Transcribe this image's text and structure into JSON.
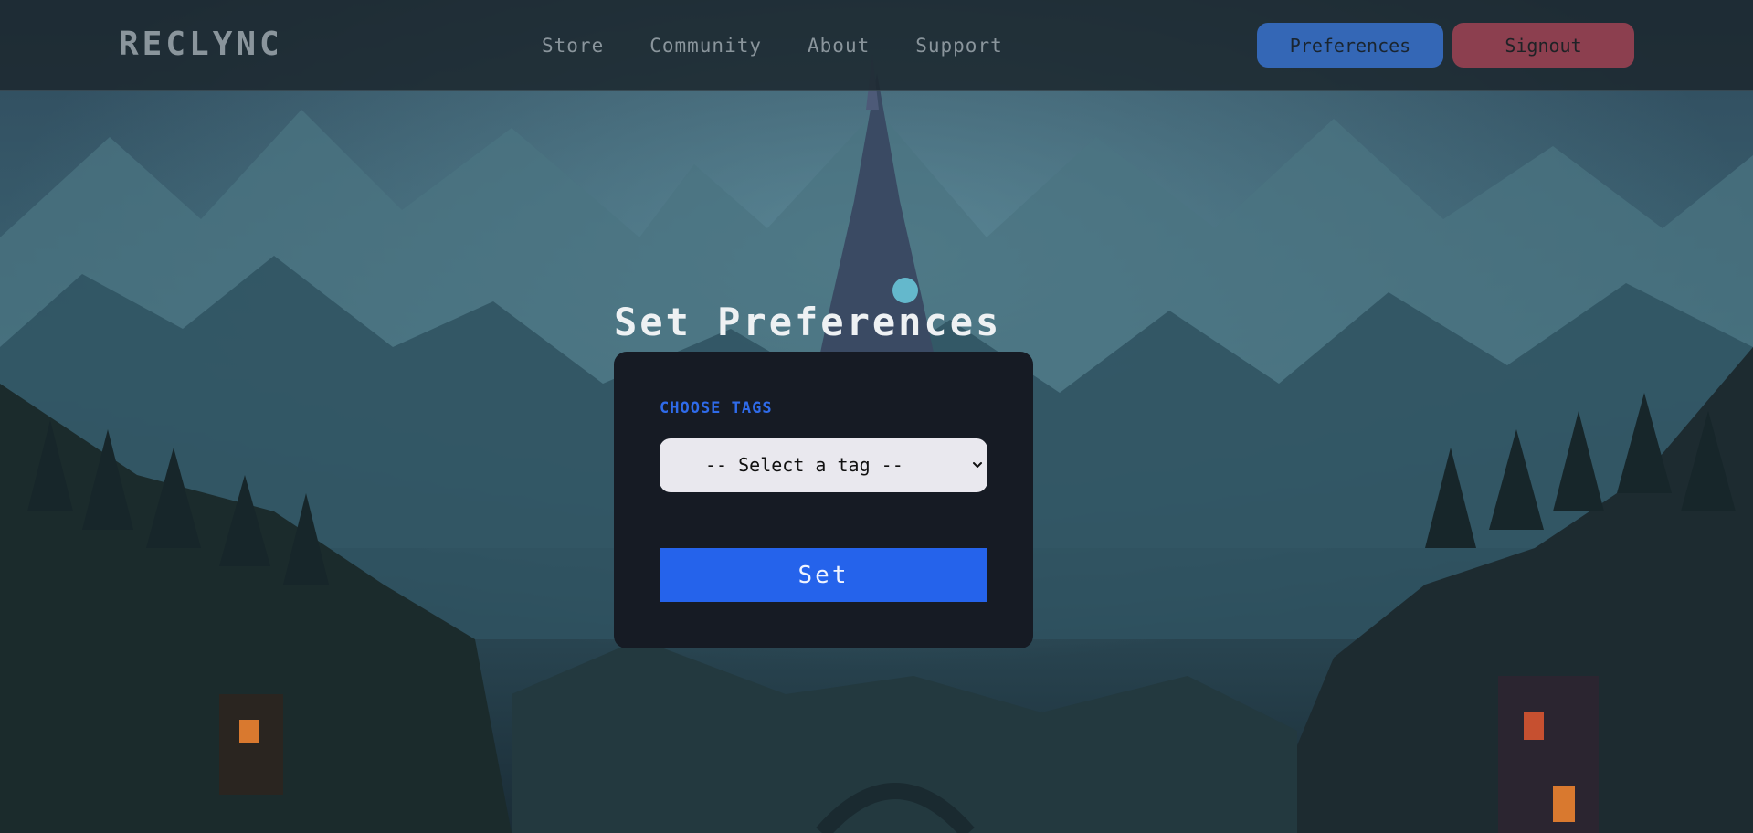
{
  "header": {
    "logo": "RECLYNC",
    "nav": [
      "Store",
      "Community",
      "About",
      "Support"
    ],
    "preferences_label": "Preferences",
    "signout_label": "Signout"
  },
  "main": {
    "title": "Set Preferences",
    "form": {
      "field_label": "CHOOSE TAGS",
      "select_value": "-- Select a tag --",
      "submit_label": "Set"
    }
  },
  "colors": {
    "accent": "#2563eb",
    "signout": "#8c3f4f",
    "card_bg": "#161b24",
    "label": "#2f6bea"
  },
  "icons": {
    "select_arrow": "chevron-down-icon"
  }
}
